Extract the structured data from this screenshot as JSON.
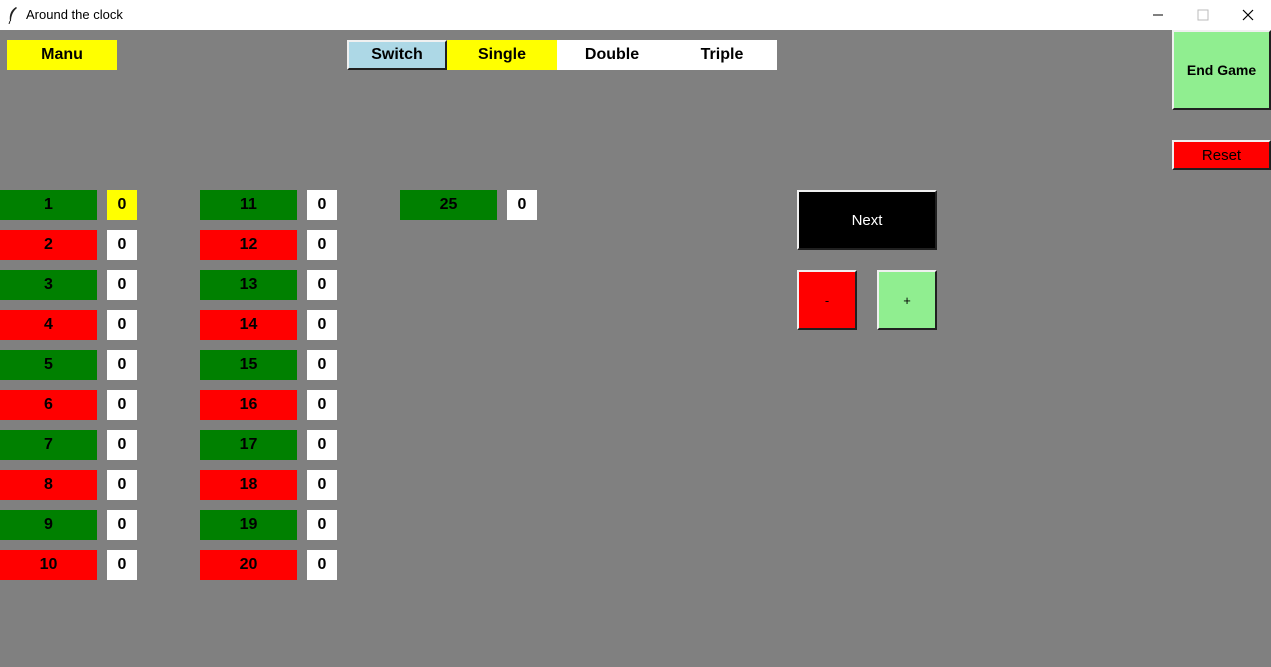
{
  "window": {
    "title": "Around the clock"
  },
  "toolbar": {
    "menu_label": "Manu",
    "switch_label": "Switch",
    "modes": [
      "Single",
      "Double",
      "Triple"
    ],
    "selected_mode": "Single"
  },
  "side": {
    "end_game_label": "End Game",
    "reset_label": "Reset"
  },
  "controls": {
    "next_label": "Next",
    "minus_label": "-",
    "plus_label": "+"
  },
  "colors": {
    "background": "#808080",
    "green": "#008000",
    "red": "#ff0000",
    "yellow": "#ffff00",
    "light_blue": "#add8e6",
    "light_green": "#90ee90",
    "black": "#000000"
  },
  "targets": [
    {
      "label": "1",
      "count": "0",
      "color": "green",
      "highlight": true
    },
    {
      "label": "2",
      "count": "0",
      "color": "red"
    },
    {
      "label": "3",
      "count": "0",
      "color": "green"
    },
    {
      "label": "4",
      "count": "0",
      "color": "red"
    },
    {
      "label": "5",
      "count": "0",
      "color": "green"
    },
    {
      "label": "6",
      "count": "0",
      "color": "red"
    },
    {
      "label": "7",
      "count": "0",
      "color": "green"
    },
    {
      "label": "8",
      "count": "0",
      "color": "red"
    },
    {
      "label": "9",
      "count": "0",
      "color": "green"
    },
    {
      "label": "10",
      "count": "0",
      "color": "red"
    },
    {
      "label": "11",
      "count": "0",
      "color": "green"
    },
    {
      "label": "12",
      "count": "0",
      "color": "red"
    },
    {
      "label": "13",
      "count": "0",
      "color": "green"
    },
    {
      "label": "14",
      "count": "0",
      "color": "red"
    },
    {
      "label": "15",
      "count": "0",
      "color": "green"
    },
    {
      "label": "16",
      "count": "0",
      "color": "red"
    },
    {
      "label": "17",
      "count": "0",
      "color": "green"
    },
    {
      "label": "18",
      "count": "0",
      "color": "red"
    },
    {
      "label": "19",
      "count": "0",
      "color": "green"
    },
    {
      "label": "20",
      "count": "0",
      "color": "red"
    },
    {
      "label": "25",
      "count": "0",
      "color": "green"
    }
  ]
}
